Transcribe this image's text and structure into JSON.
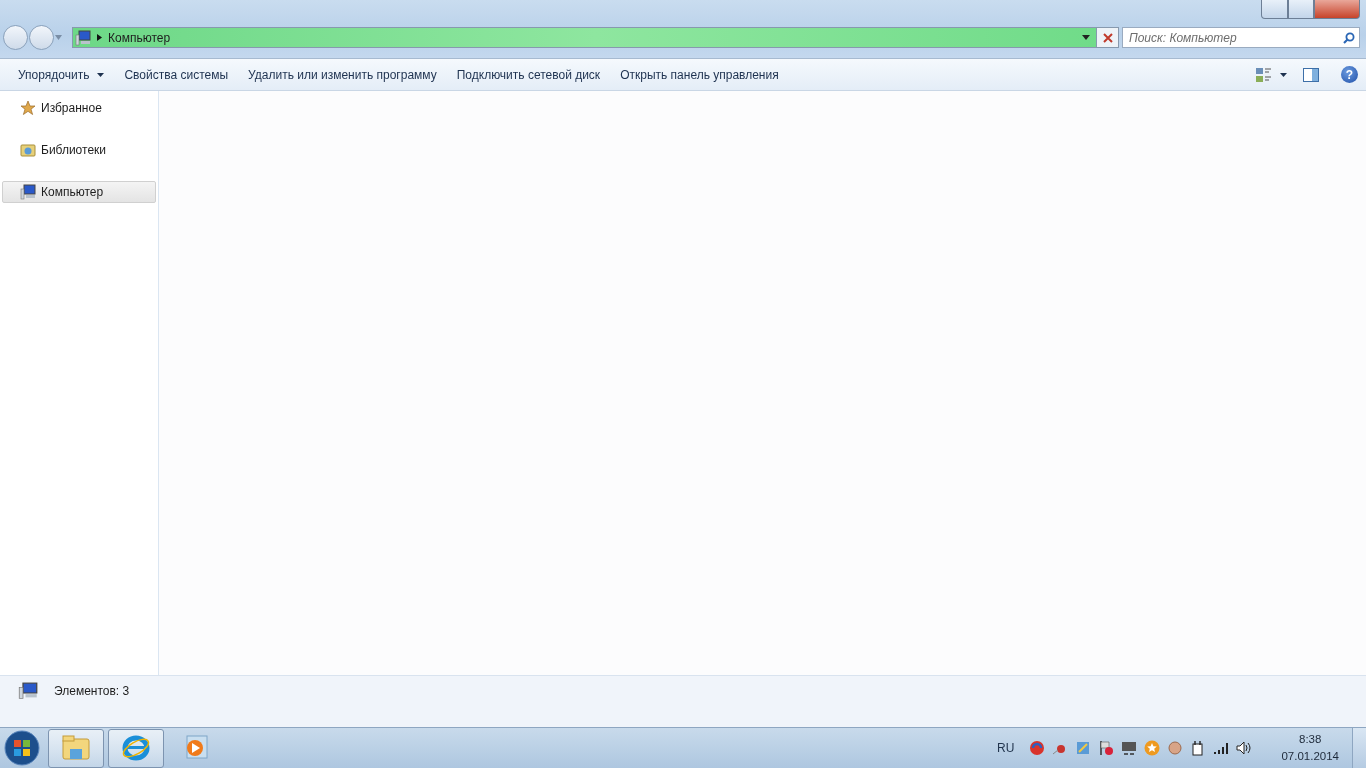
{
  "address_bar": {
    "path": "Компьютер"
  },
  "search": {
    "placeholder": "Поиск: Компьютер"
  },
  "toolbar": [
    {
      "label": "Упорядочить",
      "dropdown": true
    },
    {
      "label": "Свойства системы",
      "dropdown": false
    },
    {
      "label": "Удалить или изменить программу",
      "dropdown": false
    },
    {
      "label": "Подключить сетевой диск",
      "dropdown": false
    },
    {
      "label": "Открыть панель управления",
      "dropdown": false
    }
  ],
  "sidebar": {
    "items": [
      {
        "label": "Избранное",
        "kind": "favorites",
        "selected": false
      },
      {
        "label": "Библиотеки",
        "kind": "libraries",
        "selected": false
      },
      {
        "label": "Компьютер",
        "kind": "computer",
        "selected": true
      }
    ]
  },
  "help_button": {
    "label": "?"
  },
  "status_bar": {
    "text": "Элементов: 3"
  },
  "taskbar": {
    "apps": [
      {
        "kind": "explorer",
        "running": true
      },
      {
        "kind": "browser",
        "running": true
      },
      {
        "kind": "media",
        "running": false
      }
    ],
    "language": "RU",
    "time": "8:38",
    "date": "07.01.2014"
  }
}
